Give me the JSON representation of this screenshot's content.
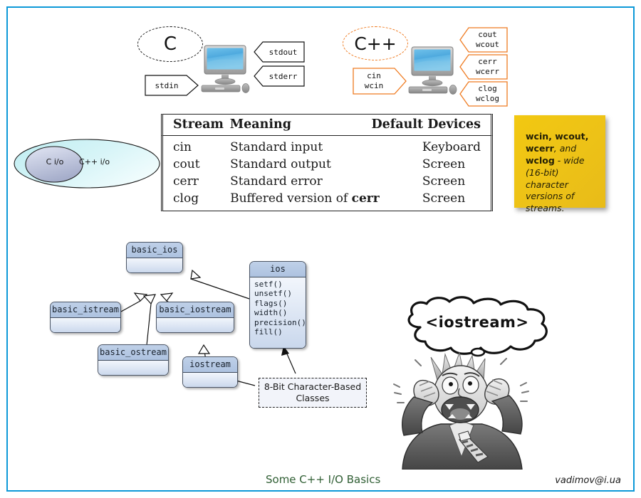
{
  "page": {
    "border_color": "#0c99d8",
    "background": "#ffffff"
  },
  "c_section": {
    "label": "C",
    "input": {
      "label": "stdin"
    },
    "outputs": [
      {
        "label": "stdout"
      },
      {
        "label": "stderr"
      }
    ],
    "device_icon": "monitor-icon"
  },
  "cpp_section": {
    "label": "C++",
    "accent": "#ef7b21",
    "input": {
      "line1": "cin",
      "line2": "wcin"
    },
    "outputs": [
      {
        "line1": "cout",
        "line2": "wcout"
      },
      {
        "line1": "cerr",
        "line2": "wcerr"
      },
      {
        "line1": "clog",
        "line2": "wclog"
      }
    ],
    "device_icon": "monitor-icon"
  },
  "venn": {
    "inner_label": "C i/o",
    "outer_label": "C++ i/o"
  },
  "stream_table": {
    "headers": [
      "Stream",
      "Meaning",
      "Default Devices"
    ],
    "rows": [
      {
        "stream": "cin",
        "meaning": "Standard input",
        "meaning_code": "",
        "device": "Keyboard"
      },
      {
        "stream": "cout",
        "meaning": "Standard output",
        "meaning_code": "",
        "device": "Screen"
      },
      {
        "stream": "cerr",
        "meaning": "Standard error",
        "meaning_code": "",
        "device": "Screen"
      },
      {
        "stream": "clog",
        "meaning": "Buffered version of ",
        "meaning_code": "cerr",
        "device": "Screen"
      }
    ]
  },
  "sticky_note": {
    "bold1": "wcin, wcout,",
    "bold2": "wcerr",
    "mid": ", and ",
    "bold3": "wclog",
    "rest": " - wide (16-bit) character versions of streams.",
    "color": "#f0c419"
  },
  "uml": {
    "basic_ios": {
      "title": "basic_ios"
    },
    "basic_istream": {
      "title": "basic_istream"
    },
    "basic_ostream": {
      "title": "basic_ostream"
    },
    "basic_iostream": {
      "title": "basic_iostream"
    },
    "iostream": {
      "title": "iostream"
    },
    "ios": {
      "title": "ios",
      "members": [
        "setf()",
        "unsetf()",
        "flags()",
        "width()",
        "precision()",
        "fill()"
      ]
    },
    "note": {
      "line1": "8-Bit Character-Based",
      "line2": "Classes"
    }
  },
  "bubble": {
    "text": "<iostream>"
  },
  "footer": {
    "title": "Some C++ I/O Basics",
    "email": "vadimov@i.ua"
  }
}
